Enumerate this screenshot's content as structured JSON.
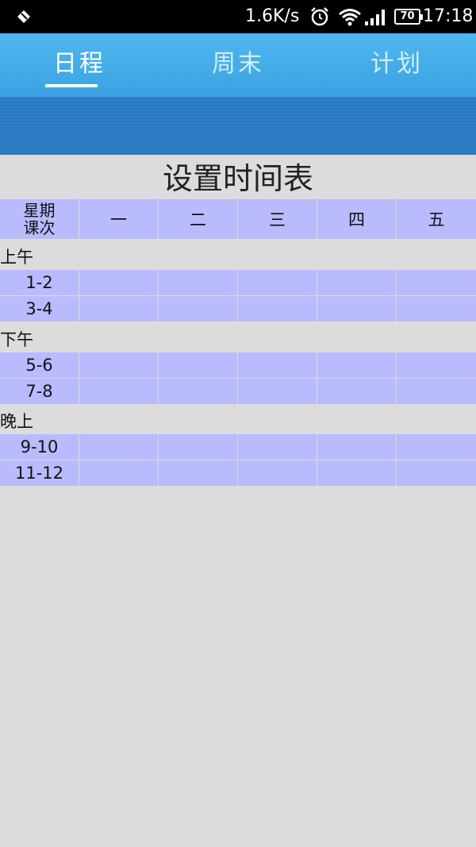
{
  "status_bar": {
    "net_speed": "1.6K/s",
    "battery": "70",
    "time": "17:18"
  },
  "tabs": [
    {
      "label": "日程",
      "active": true
    },
    {
      "label": "周末",
      "active": false
    },
    {
      "label": "计划",
      "active": false
    }
  ],
  "page_title": "设置时间表",
  "table": {
    "corner_top": "星期",
    "corner_bottom": "课次",
    "days": [
      "一",
      "二",
      "三",
      "四",
      "五"
    ],
    "sections": [
      {
        "label": "上午",
        "rows": [
          "1-2",
          "3-4"
        ]
      },
      {
        "label": "下午",
        "rows": [
          "5-6",
          "7-8"
        ]
      },
      {
        "label": "晚上",
        "rows": [
          "9-10",
          "11-12"
        ]
      }
    ]
  },
  "colors": {
    "cell_bg": "#babaff",
    "tab_bar": "#3aa2e2",
    "page_bg": "#dcdcdc"
  }
}
